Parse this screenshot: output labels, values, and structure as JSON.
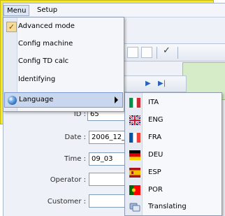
{
  "menubar": {
    "menu": "Menu",
    "setup": "Setup"
  },
  "menu": {
    "items": [
      {
        "label": "Advanced mode",
        "checked": true
      },
      {
        "label": "Config machine"
      },
      {
        "label": "Config TD calc"
      },
      {
        "label": "Identifying"
      },
      {
        "label": "Language",
        "submenu": true
      }
    ]
  },
  "languages": [
    {
      "code": "ITA",
      "flag": "italy-flag-icon"
    },
    {
      "code": "ENG",
      "flag": "uk-flag-icon"
    },
    {
      "code": "FRA",
      "flag": "france-flag-icon"
    },
    {
      "code": "DEU",
      "flag": "germany-flag-icon"
    },
    {
      "code": "ESP",
      "flag": "spain-flag-icon"
    },
    {
      "code": "POR",
      "flag": "portugal-flag-icon"
    },
    {
      "code": "Translating",
      "flag": "translate-icon"
    }
  ],
  "form": {
    "id_label": "ID :",
    "id_value": "65",
    "date_label": "Date :",
    "date_value": "2006_12_",
    "time_label": "Time :",
    "time_value": "09_03",
    "operator_label": "Operator :",
    "operator_value": "",
    "customer_label": "Customer :",
    "customer_value": ""
  },
  "colors": {
    "frame": "#f5e82b",
    "highlight": "#c8d6ee",
    "checked": "#f6dc9c"
  }
}
